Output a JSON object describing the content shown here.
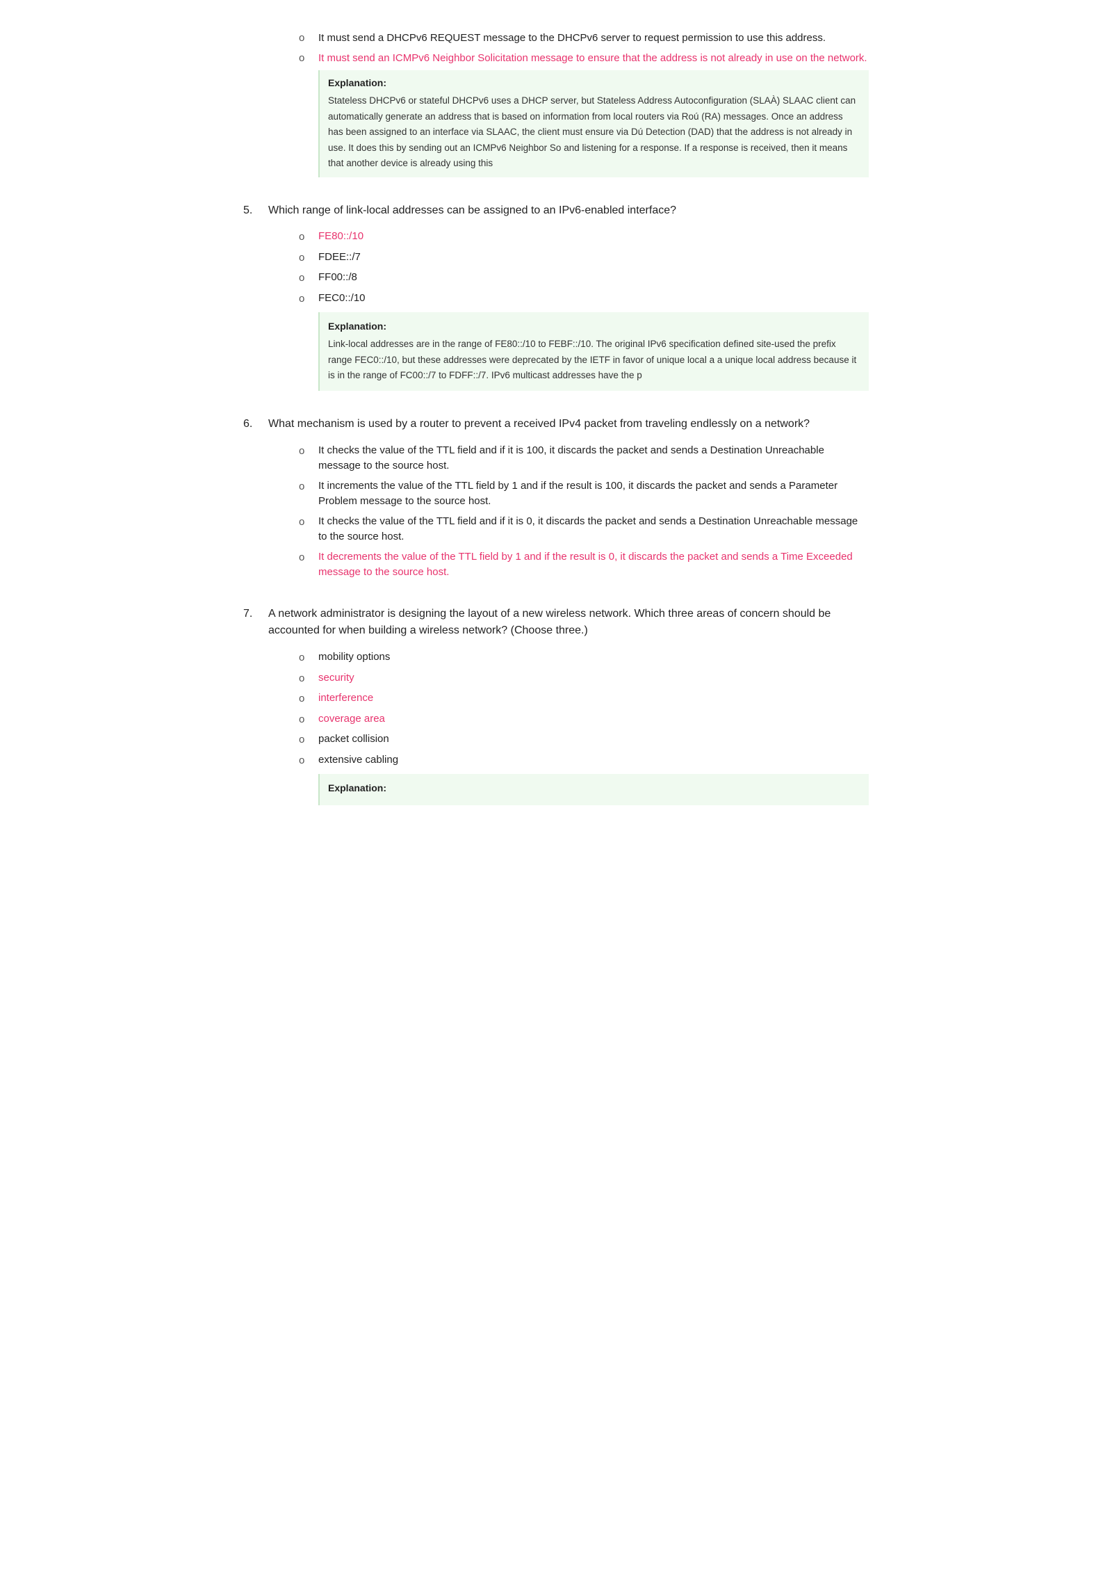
{
  "page": {
    "background": "#ffffff"
  },
  "top_section": {
    "bullet1": "It must send a DHCPv6 REQUEST message to the DHCPv6 server to request permission to use this address.",
    "bullet2_correct": "It must send an ICMPv6 Neighbor Solicitation message to ensure that the address is not already in use on the network.",
    "explanation_label": "Explanation:",
    "explanation_text": "Stateless DHCPv6 or stateful DHCPv6 uses a DHCP server, but Stateless Address Autoconfiguration (SLAÀ) SLAAC client can automatically generate an address that is based on information from local routers via Roú (RA) messages. Once an address has been assigned to an interface via SLAAC, the client must ensure via Dú Detection (DAD) that the address is not already in use. It does this by sending out an ICMPv6 Neighbor So and listening for a response. If a response is received, then it means that another device is already using this"
  },
  "q5": {
    "number": "5.",
    "text": "Which range of link-local addresses can be assigned to an IPv6-enabled interface?",
    "options": [
      {
        "bullet": "o",
        "text": "FE80::/10",
        "correct": true
      },
      {
        "bullet": "o",
        "text": "FDEE::/7",
        "correct": false
      },
      {
        "bullet": "o",
        "text": "FF00::/8",
        "correct": false
      },
      {
        "bullet": "o",
        "text": "FEC0::/10",
        "correct": false
      }
    ],
    "explanation_label": "Explanation:",
    "explanation_text": "Link-local addresses are in the range of FE80::/10 to FEBF::/10. The original IPv6 specification defined site-used the prefix range FEC0::/10, but these addresses were deprecated by the IETF in favor of unique local a a unique local address because it is in the range of FC00::/7 to FDFF::/7. IPv6 multicast addresses have the p"
  },
  "q6": {
    "number": "6.",
    "text": "What mechanism is used by a router to prevent a received IPv4 packet from traveling endlessly on a network?",
    "options": [
      {
        "bullet": "o",
        "text": "It checks the value of the TTL field and if it is 100, it discards the packet and sends a Destination Unreachable message to the source host.",
        "correct": false
      },
      {
        "bullet": "o",
        "text": "It increments the value of the TTL field by 1 and if the result is 100, it discards the packet and sends a Parameter Problem message to the source host.",
        "correct": false
      },
      {
        "bullet": "o",
        "text": "It checks the value of the TTL field and if it is 0, it discards the packet and sends a Destination Unreachable message to the source host.",
        "correct": false
      },
      {
        "bullet": "o",
        "text": "It decrements the value of the TTL field by 1 and if the result is 0, it discards the packet and sends a Time Exceeded message to the source host.",
        "correct": true
      }
    ]
  },
  "q7": {
    "number": "7.",
    "text": "A network administrator is designing the layout of a new wireless network. Which three areas of concern should be accounted for when building a wireless network? (Choose three.)",
    "options": [
      {
        "bullet": "o",
        "text": "mobility options",
        "correct": false
      },
      {
        "bullet": "o",
        "text": "security",
        "correct": true
      },
      {
        "bullet": "o",
        "text": "interference",
        "correct": true
      },
      {
        "bullet": "o",
        "text": "coverage area",
        "correct": true
      },
      {
        "bullet": "o",
        "text": "packet collision",
        "correct": false
      },
      {
        "bullet": "o",
        "text": "extensive cabling",
        "correct": false
      }
    ],
    "explanation_label": "Explanation:"
  }
}
